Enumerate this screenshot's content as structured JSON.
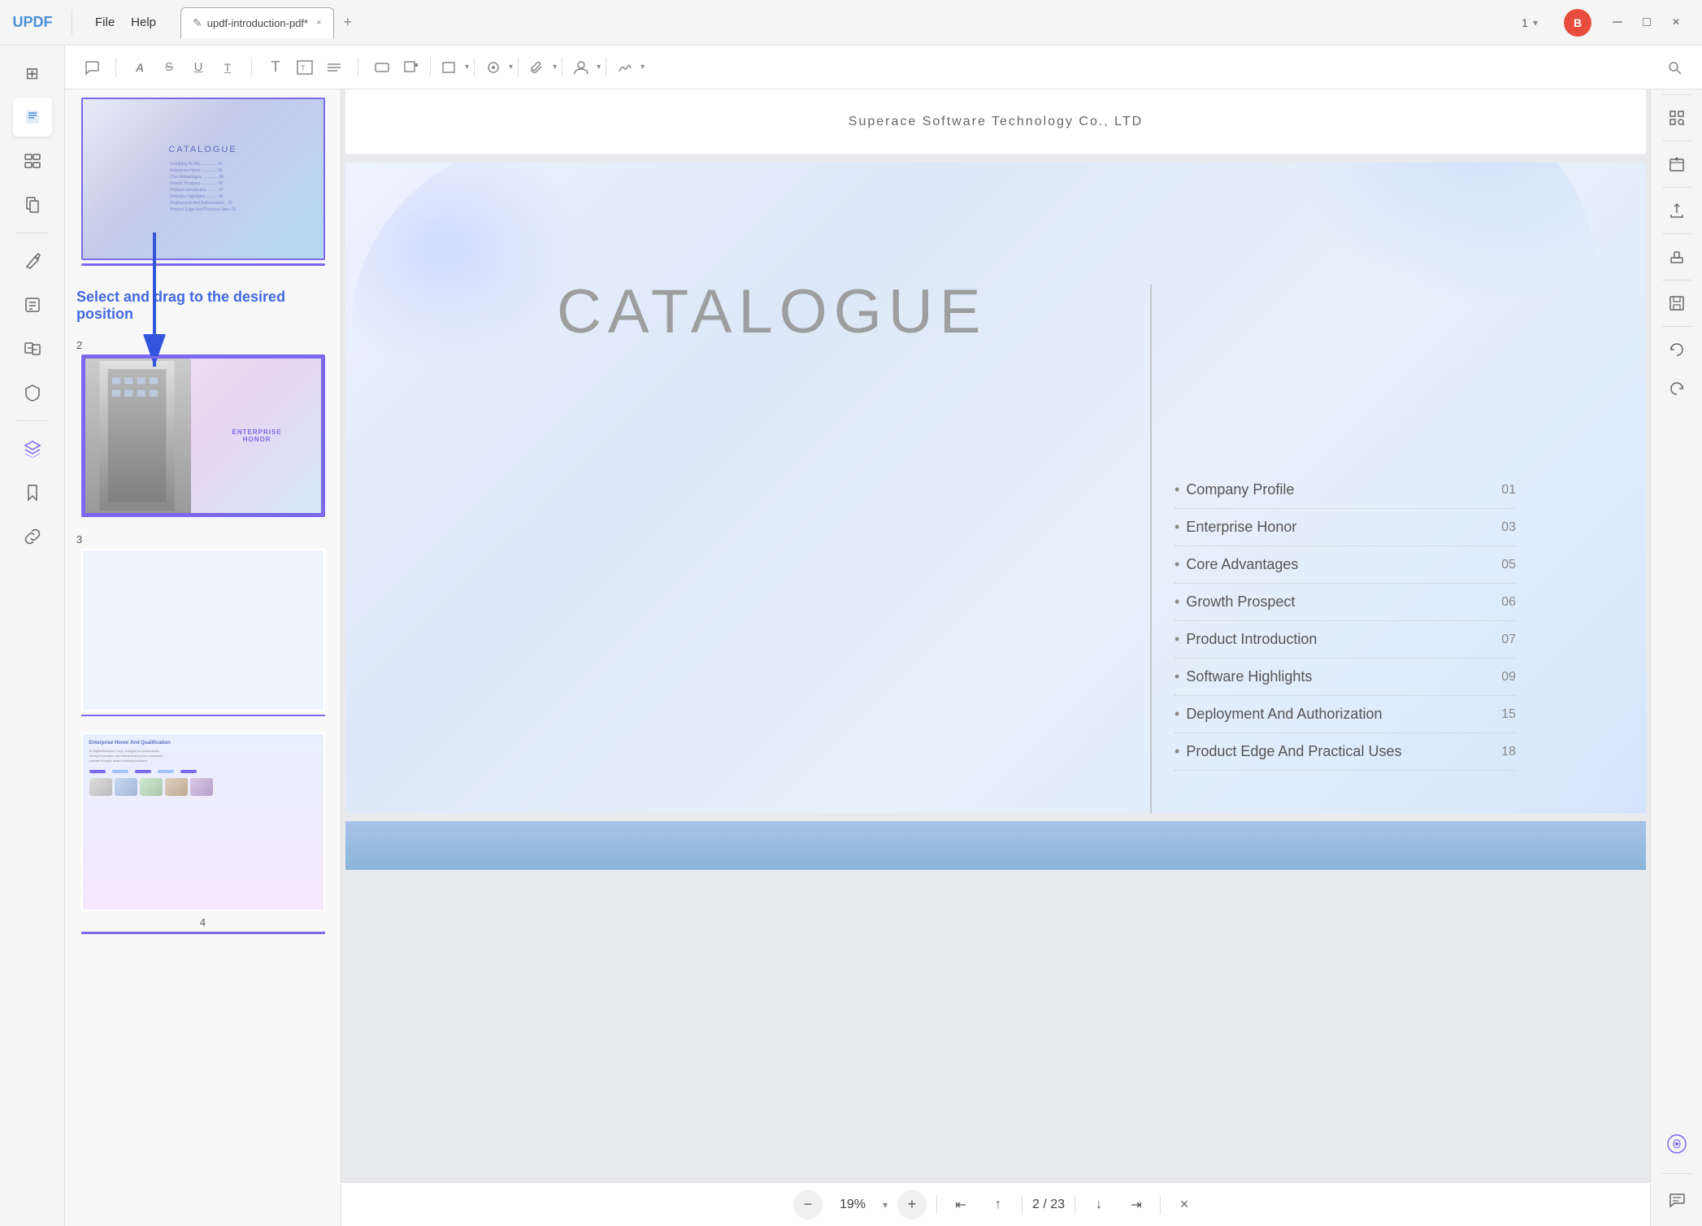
{
  "app": {
    "logo": "UPDF",
    "menus": [
      "File",
      "Help"
    ],
    "tab": {
      "icon": "✎",
      "label": "updf-introduction-pdf*",
      "close": "×",
      "add": "+"
    },
    "page_nav": "1",
    "user_avatar": "B",
    "window_controls": {
      "minimize": "─",
      "maximize": "□",
      "close": "×"
    }
  },
  "toolbar": {
    "tools": [
      {
        "name": "comment-icon",
        "symbol": "💬"
      },
      {
        "name": "highlight-icon",
        "symbol": "A"
      },
      {
        "name": "strikethrough-icon",
        "symbol": "S"
      },
      {
        "name": "underline-icon",
        "symbol": "U"
      },
      {
        "name": "underline2-icon",
        "symbol": "T̲"
      },
      {
        "name": "text-icon",
        "symbol": "T"
      },
      {
        "name": "text-box-icon",
        "symbol": "T⃞"
      },
      {
        "name": "list-icon",
        "symbol": "☰"
      },
      {
        "name": "eraser-icon",
        "symbol": "◻"
      },
      {
        "name": "shape-icon",
        "symbol": "▭"
      },
      {
        "name": "pen-icon",
        "symbol": "✏"
      },
      {
        "name": "attach-icon",
        "symbol": "📎"
      },
      {
        "name": "user-icon",
        "symbol": "👤"
      },
      {
        "name": "signature-icon",
        "symbol": "✍"
      },
      {
        "name": "search-icon",
        "symbol": "🔍"
      }
    ]
  },
  "left_sidebar": {
    "icons": [
      {
        "name": "thumbnails-icon",
        "symbol": "⊞",
        "active": false
      },
      {
        "name": "annotate-icon",
        "symbol": "✏",
        "active": true
      },
      {
        "name": "organize-icon",
        "symbol": "☰",
        "active": false
      },
      {
        "name": "pages-icon",
        "symbol": "⊟",
        "active": false
      },
      {
        "name": "edit-icon",
        "symbol": "✎",
        "active": false
      },
      {
        "name": "forms-icon",
        "symbol": "📋",
        "active": false
      },
      {
        "name": "convert-icon",
        "symbol": "🔄",
        "active": false
      },
      {
        "name": "protect-icon",
        "symbol": "🛡",
        "active": false
      },
      {
        "name": "layers-icon",
        "symbol": "◈",
        "active": false
      },
      {
        "name": "bookmark-icon",
        "symbol": "🔖",
        "active": false
      },
      {
        "name": "link-icon",
        "symbol": "🔗",
        "active": false
      }
    ]
  },
  "right_sidebar": {
    "icons": [
      {
        "name": "ocr-icon",
        "symbol": "OCR"
      },
      {
        "name": "scan-icon",
        "symbol": "⊡"
      },
      {
        "name": "extract-icon",
        "symbol": "↗"
      },
      {
        "name": "upload-icon",
        "symbol": "⬆"
      },
      {
        "name": "stamp-icon",
        "symbol": "◻"
      },
      {
        "name": "save-icon",
        "symbol": "💾"
      },
      {
        "name": "undo-icon",
        "symbol": "↩"
      },
      {
        "name": "redo-icon",
        "symbol": "↪"
      },
      {
        "name": "ai-icon",
        "symbol": "✦"
      }
    ]
  },
  "thumbnails": [
    {
      "page_num": "",
      "type": "catalogue",
      "selected": true
    },
    {
      "page_num": "2",
      "type": "enterprise",
      "selected": false,
      "drag_over": true
    },
    {
      "page_num": "3",
      "type": "blank",
      "selected": false
    },
    {
      "page_num": "4",
      "type": "enterprise-honor",
      "selected": false
    }
  ],
  "drag_tooltip": "Select and drag to the desired position",
  "pdf": {
    "company": "Superace Software Technology Co., LTD",
    "page2": {
      "title": "CATALOGUE",
      "items": [
        {
          "name": "Company Profile",
          "num": "01"
        },
        {
          "name": "Enterprise Honor",
          "num": "03"
        },
        {
          "name": "Core Advantages",
          "num": "05"
        },
        {
          "name": "Growth Prospect",
          "num": "06"
        },
        {
          "name": "Product Introduction",
          "num": "07"
        },
        {
          "name": "Software Highlights",
          "num": "09"
        },
        {
          "name": "Deployment And Authorization",
          "num": "15"
        },
        {
          "name": "Product Edge And Practical Uses",
          "num": "18"
        }
      ]
    }
  },
  "zoom": {
    "value": "19%",
    "current_page": "2",
    "total_pages": "23"
  }
}
